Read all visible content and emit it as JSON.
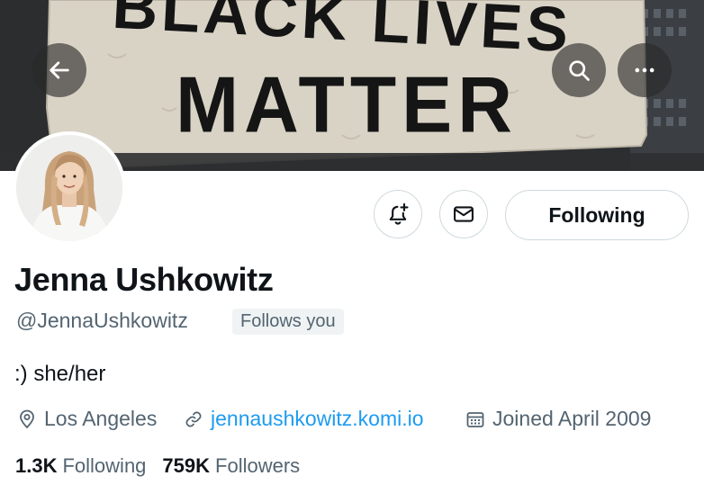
{
  "banner": {
    "line1": "BLACK LIVES",
    "line2": "MATTER"
  },
  "topbar": {
    "back_icon": "arrow-left-icon",
    "search_icon": "search-icon",
    "more_icon": "more-horizontal-icon"
  },
  "profile": {
    "name": "Jenna Ushkowitz",
    "handle": "@JennaUshkowitz",
    "follows_you": "Follows you",
    "bio": ":) she/her",
    "location": "Los Angeles",
    "website": "jennaushkowitz.komi.io",
    "joined": "Joined April 2009",
    "following_count": "1.3K",
    "following_label": "Following",
    "followers_count": "759K",
    "followers_label": "Followers"
  },
  "actions": {
    "notify_icon": "bell-plus-icon",
    "message_icon": "mail-icon",
    "follow_state": "Following"
  },
  "colors": {
    "text_primary": "#0f1419",
    "text_secondary": "#536471",
    "link": "#1d9bf0",
    "border": "#cfd9de",
    "badge_bg": "#eff3f4"
  }
}
